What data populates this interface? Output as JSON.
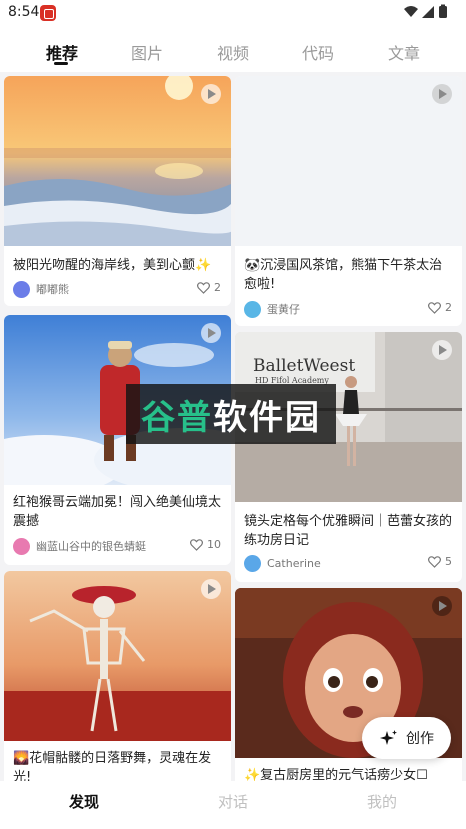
{
  "status_bar": {
    "time": "8:54",
    "icons": [
      "app-badge-icon",
      "wifi-icon",
      "signal-icon",
      "battery-icon"
    ]
  },
  "tabs": [
    {
      "label": "推荐",
      "active": true
    },
    {
      "label": "图片",
      "active": false
    },
    {
      "label": "视频",
      "active": false
    },
    {
      "label": "代码",
      "active": false
    },
    {
      "label": "文章",
      "active": false
    }
  ],
  "cards": [
    {
      "title": "被阳光吻醒的海岸线，美到心颤✨",
      "author": "嘟嘟熊",
      "likes": "2",
      "avatar_color": "#6b7de8"
    },
    {
      "title": "🐼沉浸国风茶馆，熊猫下午茶太治愈啦!",
      "author": "蛋黄仔",
      "likes": "2",
      "avatar_color": "#59b6e6"
    },
    {
      "title": "红袍猴哥云端加冕！闯入绝美仙境太震撼",
      "author": "幽蓝山谷中的银色蜻蜓",
      "likes": "10",
      "avatar_color": "#e87ab0"
    },
    {
      "title": "镜头定格每个优雅瞬间｜芭蕾女孩的练功房日记",
      "author": "Catherine",
      "likes": "5",
      "avatar_color": "#5aa7e8",
      "image_text": {
        "line1": "BalletWeest",
        "line2": "HD Fifol Academy"
      }
    },
    {
      "title": "🌄花帽骷髅的日落野舞，灵魂在发光!",
      "author": "",
      "likes": "",
      "avatar_color": "#888888"
    },
    {
      "title": "✨复古厨房里的元气话痨少女☐",
      "author": "",
      "likes": "",
      "avatar_color": "#888888"
    }
  ],
  "watermark": {
    "text": "谷普软件园"
  },
  "fab": {
    "label": "创作"
  },
  "bottom_nav": [
    {
      "label": "发现",
      "active": true
    },
    {
      "label": "对话",
      "active": false
    },
    {
      "label": "我的",
      "active": false
    }
  ],
  "colors": {
    "accent": "#111111",
    "muted": "#9a9a9a",
    "background": "#f3f3f5"
  }
}
